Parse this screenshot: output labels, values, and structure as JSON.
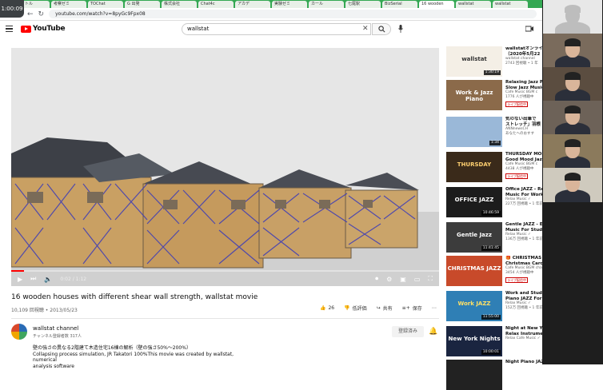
{
  "browser": {
    "badge": "1:00:09",
    "tabs": [
      "ナイトル",
      "考察ゼミ",
      "TOChat",
      "G 出発",
      "株式会社",
      "Chat4c",
      "アカデ",
      "実験ゼミ",
      "カール",
      "七尾駅",
      "BizSerial",
      "16 wooden",
      "wallstat",
      "wallstat"
    ],
    "address": "youtube.com/watch?v=8pyGc9Fpx08"
  },
  "youtube": {
    "logo": "YouTube",
    "search_value": "wallstat",
    "video": {
      "time": "0:02 / 1:12",
      "title": "16 wooden houses with different shear wall strength, wallstat movie",
      "meta": "10,109 回視聴 • 2013/05/23",
      "likes": "26",
      "dislike": "低評価",
      "share": "共有",
      "save": "保存",
      "progress": 0.03
    },
    "channel": {
      "name": "wallstat channel",
      "subs": "チャンネル登録者数 317人",
      "subscribe": "登録済み",
      "description": [
        "壁の強さの異なる2階建て木造住宅16棟の解析（壁の強さ50%～200%）",
        "Collapsing process simulation, JR Takatori 100%This movie was created by wallstat, numerical",
        "analysis software"
      ]
    },
    "sidebar": [
      {
        "title": "wallstatオンライ",
        "title2": "（2020年5月22",
        "channel": "wallstat channel",
        "views": "2743 回視聴 • 1 年",
        "duration": "1:30:19",
        "live": "",
        "thumb": "wallstat"
      },
      {
        "title": "Relaxing Jazz Pi",
        "title2": "Slow Jazz Music",
        "channel": "Cafe Music BGM c",
        "views": "1776 人が視聴中",
        "duration": "",
        "live": "ライブ配信中",
        "thumb": "Work & Jazz Piano"
      },
      {
        "title": "気のない出筆で",
        "title2": "ストレッチ」羽根",
        "channel": "ANNnewsCH",
        "views": "あなたへのおすす",
        "duration": "1:34",
        "live": "",
        "thumb": ""
      },
      {
        "title": "THURSDAY MOR",
        "title2": "Good Mood Jazz",
        "channel": "Cafe Music BGM c",
        "views": "4438 人が視聴中",
        "duration": "",
        "live": "ライブ配信中",
        "thumb": "THURSDAY"
      },
      {
        "title": "Office JAZZ - Re",
        "title2": "Music For Work,",
        "channel": "Relax Music ✓",
        "views": "227万 回視聴 • 1 年前 に配信済み",
        "duration": "10:46:59",
        "live": "",
        "thumb": "OFFICE JAZZ"
      },
      {
        "title": "Gentle JAZZ - Elegant JAZZ",
        "title2": "Music For Study, Work, Readin...",
        "channel": "Relax Music ✓",
        "views": "136万 回視聴 • 1 年前 に配信済み",
        "duration": "11:41:45",
        "live": "",
        "thumb": "Gentle Jazz"
      },
      {
        "title": "🎁 CHRISTMAS JAZZ 2021:",
        "title2": "Christmas Carol Jazz...",
        "channel": "Cafe Music BGM channel ✓",
        "views": "3454 人が視聴中",
        "duration": "",
        "live": "ライブ配信中",
        "thumb": "CHRISTMAS JAZZ"
      },
      {
        "title": "Work and Study JAZZ - Gentle",
        "title2": "Piano JAZZ For Focus and...",
        "channel": "Relax Music ✓",
        "views": "152万 回視聴 • 1 年前 に配信済み",
        "duration": "11:55:00",
        "live": "",
        "thumb": "Work JAZZ"
      },
      {
        "title": "Night at New York Jazz Music -",
        "title2": "Relax Instrumental JAZZ...",
        "channel": "Relax Cafe Music ✓",
        "views": "",
        "duration": "10:00:01",
        "live": "",
        "thumb": "New York Nights"
      },
      {
        "title": "Night Piano JAZZ - Slow Sax",
        "title2": "",
        "channel": "",
        "views": "",
        "duration": "",
        "live": "",
        "thumb": ""
      }
    ]
  },
  "zoom": {
    "participants": 6
  }
}
